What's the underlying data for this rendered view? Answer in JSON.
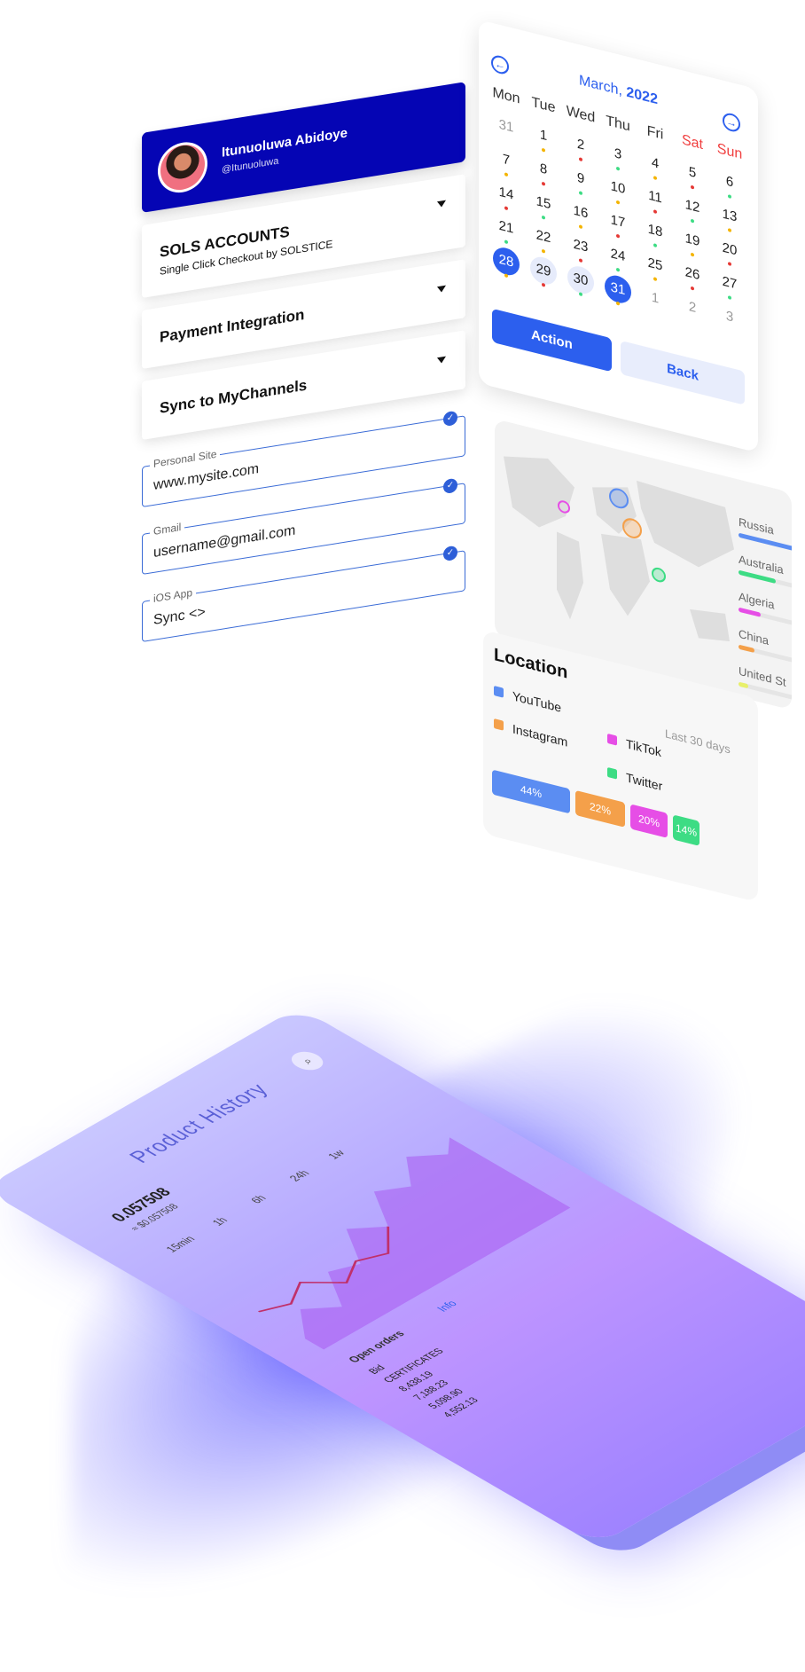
{
  "profile": {
    "name": "Itunuoluwa Abidoye",
    "handle": "@Itunuoluwa"
  },
  "accounts": [
    {
      "title": "SOLS ACCOUNTS",
      "subtitle": "Single Click Checkout by SOLSTICE"
    },
    {
      "title": "Payment Integration"
    },
    {
      "title": "Sync to MyChannels"
    }
  ],
  "fields": [
    {
      "label": "Personal Site",
      "value": "www.mysite.com"
    },
    {
      "label": "Gmail",
      "value": "username@gmail.com"
    },
    {
      "label": "iOS App",
      "value": "Sync <>"
    }
  ],
  "calendar": {
    "month": "March,",
    "year": "2022",
    "weekdays": [
      "Mon",
      "Tue",
      "Wed",
      "Thu",
      "Fri",
      "Sat",
      "Sun"
    ],
    "days": [
      [
        "31",
        "1",
        "2",
        "3",
        "4",
        "5",
        "6"
      ],
      [
        "7",
        "8",
        "9",
        "10",
        "11",
        "12",
        "13"
      ],
      [
        "14",
        "15",
        "16",
        "17",
        "18",
        "19",
        "20"
      ],
      [
        "21",
        "22",
        "23",
        "24",
        "25",
        "26",
        "27"
      ],
      [
        "28",
        "29",
        "30",
        "31",
        "1",
        "2",
        "3"
      ]
    ],
    "action_label": "Action",
    "back_label": "Back"
  },
  "map_legend": [
    {
      "label": "Russia",
      "value": 0.9,
      "color": "#5b8df2"
    },
    {
      "label": "Australia",
      "value": 0.6,
      "color": "#3ddc84"
    },
    {
      "label": "Algeria",
      "value": 0.35,
      "color": "#e64ee6"
    },
    {
      "label": "China",
      "value": 0.25,
      "color": "#f4a04a"
    },
    {
      "label": "United St",
      "value": 0.15,
      "color": "#e8f06a"
    }
  ],
  "location": {
    "title": "Location",
    "period": "Last 30 days",
    "legend": [
      {
        "label": "YouTube",
        "color": "#5b8df2"
      },
      {
        "label": "TikTok",
        "color": "#e64ee6"
      },
      {
        "label": "Instagram",
        "color": "#f4a04a"
      },
      {
        "label": "Twitter",
        "color": "#3ddc84"
      }
    ],
    "shares": [
      {
        "pct": "44%",
        "color": "#5b8df2"
      },
      {
        "pct": "22%",
        "color": "#f4a04a"
      },
      {
        "pct": "20%",
        "color": "#e64ee6"
      },
      {
        "pct": "14%",
        "color": "#3ddc84"
      }
    ]
  },
  "phone": {
    "title": "Product History",
    "price": "0.057508",
    "price_sub": "≈ $0.057508",
    "tabs": [
      "15min",
      "1h",
      "6h",
      "24h",
      "1w"
    ],
    "orders_label": "Open orders",
    "info_label": "Info",
    "bids_header": "Bid",
    "bids": [
      "8,438.19",
      "7,188.23",
      "5,098.90",
      "4,552.13"
    ],
    "certificates_label": "CERTIFICATES"
  }
}
